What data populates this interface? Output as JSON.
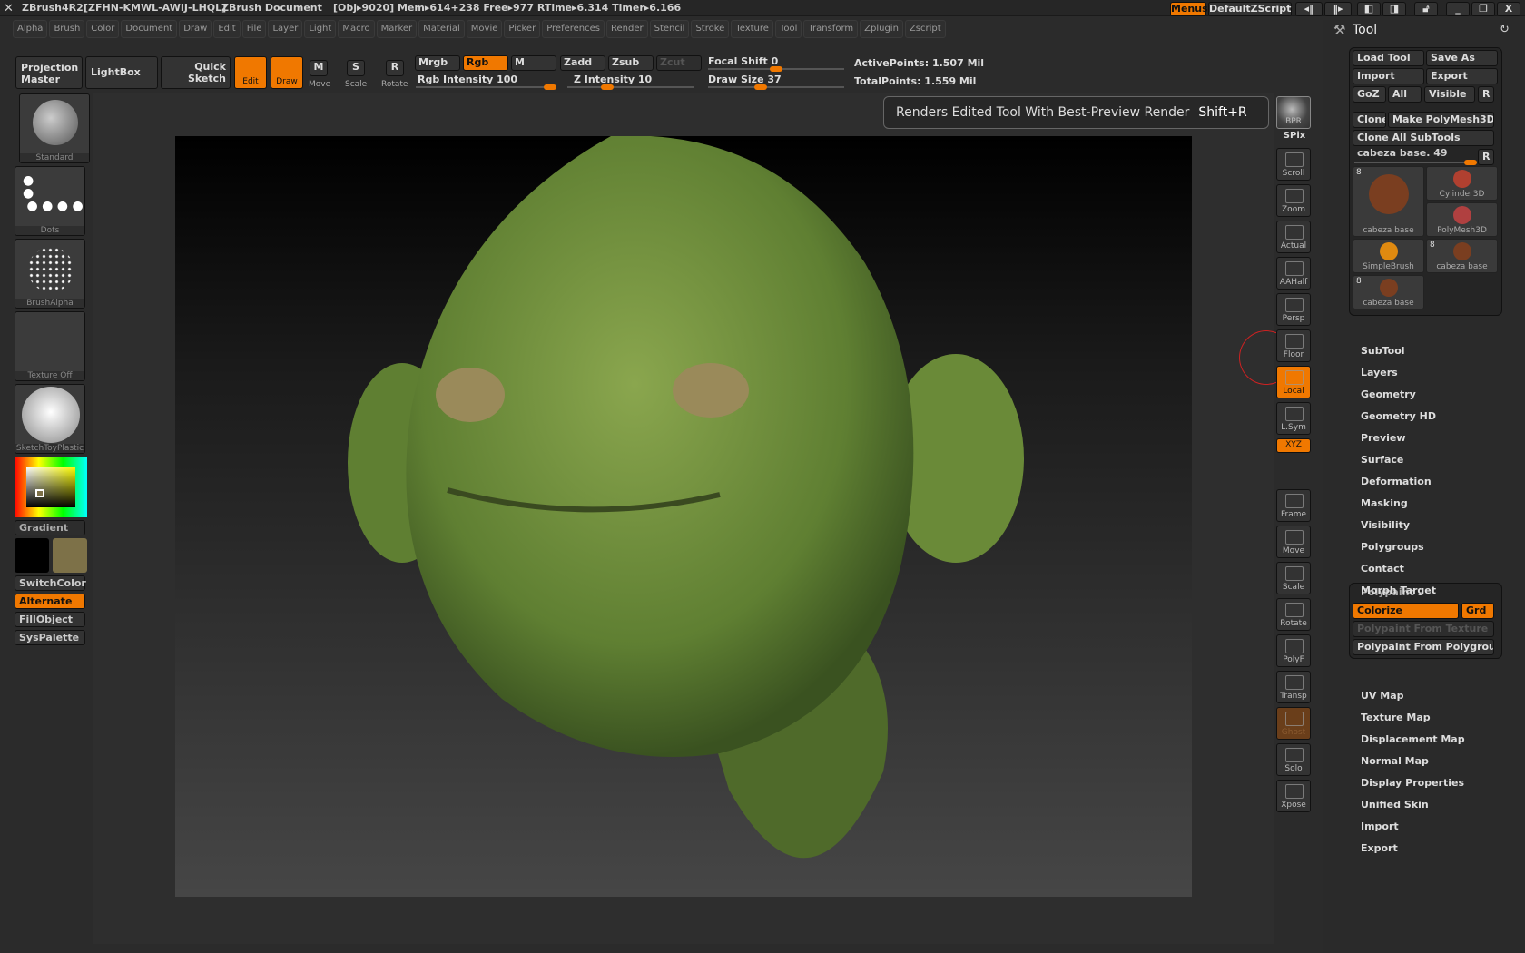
{
  "titlebar": {
    "app": "ZBrush4R2",
    "serial": "[ZFHN-KMWL-AWIJ-LHQL]",
    "doc": "ZBrush Document",
    "stats": "[Obj▸9020] Mem▸614+238 Free▸977 RTime▸6.314 Timer▸6.166",
    "menus_btn": "Menus",
    "script": "DefaultZScript"
  },
  "menus": [
    "Alpha",
    "Brush",
    "Color",
    "Document",
    "Draw",
    "Edit",
    "File",
    "Layer",
    "Light",
    "Macro",
    "Marker",
    "Material",
    "Movie",
    "Picker",
    "Preferences",
    "Render",
    "Stencil",
    "Stroke",
    "Texture",
    "Tool",
    "Transform",
    "Zplugin",
    "Zscript"
  ],
  "toolbar": {
    "projection_master": "Projection Master",
    "lightbox": "LightBox",
    "quick_sketch": "Quick Sketch",
    "edit": "Edit",
    "draw": "Draw",
    "move": "Move",
    "scale": "Scale",
    "rotate": "Rotate",
    "mrgb": "Mrgb",
    "rgb": "Rgb",
    "m": "M",
    "zadd": "Zadd",
    "zsub": "Zsub",
    "zcut": "Zcut",
    "rgb_intensity": "Rgb Intensity 100",
    "z_intensity": "Z Intensity 10",
    "focal_shift": "Focal Shift 0",
    "draw_size": "Draw Size 37",
    "active_points": "ActivePoints: 1.507 Mil",
    "total_points": "TotalPoints: 1.559 Mil"
  },
  "left": {
    "brush": "Standard",
    "stroke": "Dots",
    "alpha": "BrushAlpha",
    "texture": "Texture Off",
    "material": "SketchToyPlastic",
    "gradient": "Gradient",
    "switch_color": "SwitchColor",
    "alternate": "Alternate",
    "fill_object": "FillObject",
    "sys_palette": "SysPalette",
    "main_color": "#7d7148",
    "secondary_color": "#000000"
  },
  "tooltip": {
    "text": "Renders Edited Tool With Best-Preview Render",
    "shortcut": "Shift+R"
  },
  "shelf": {
    "bpr": "BPR",
    "spix": "SPix",
    "buttons": [
      "Scroll",
      "Zoom",
      "Actual",
      "AAHalf",
      "Persp",
      "Floor",
      "Local",
      "L.Sym",
      "XYZ",
      "Frame",
      "Move",
      "Scale",
      "Rotate",
      "PolyF",
      "Transp",
      "Ghost",
      "Solo",
      "Xpose"
    ]
  },
  "tool": {
    "title": "Tool",
    "load": "Load Tool",
    "save_as": "Save As",
    "import": "Import",
    "export": "Export",
    "goz": "GoZ",
    "all": "All",
    "visible": "Visible",
    "r": "R",
    "clone": "Clone",
    "make_polymesh": "Make PolyMesh3D",
    "clone_all": "Clone All SubTools",
    "slider": "cabeza base. 49",
    "thumbs": [
      {
        "label": "cabeza base",
        "count": "8"
      },
      {
        "label": "Cylinder3D"
      },
      {
        "label": "PolyMesh3D"
      },
      {
        "label": "SimpleBrush"
      },
      {
        "label": "cabeza base",
        "count": "8"
      },
      {
        "label": "cabeza base",
        "count": "8"
      }
    ],
    "menu_top": [
      "SubTool",
      "Layers",
      "Geometry",
      "Geometry HD",
      "Preview",
      "Surface",
      "Deformation",
      "Masking",
      "Visibility",
      "Polygroups",
      "Contact",
      "Morph Target"
    ],
    "polypaint": {
      "title": "Polypaint",
      "colorize": "Colorize",
      "grd": "Grd",
      "from_texture": "Polypaint From Texture",
      "from_polygroup": "Polypaint From Polygroup"
    },
    "menu_bottom": [
      "UV Map",
      "Texture Map",
      "Displacement Map",
      "Normal Map",
      "Display Properties",
      "Unified Skin",
      "Import",
      "Export"
    ]
  },
  "colors": {
    "accent": "#f07800",
    "model_green": "#6e8f3a"
  }
}
